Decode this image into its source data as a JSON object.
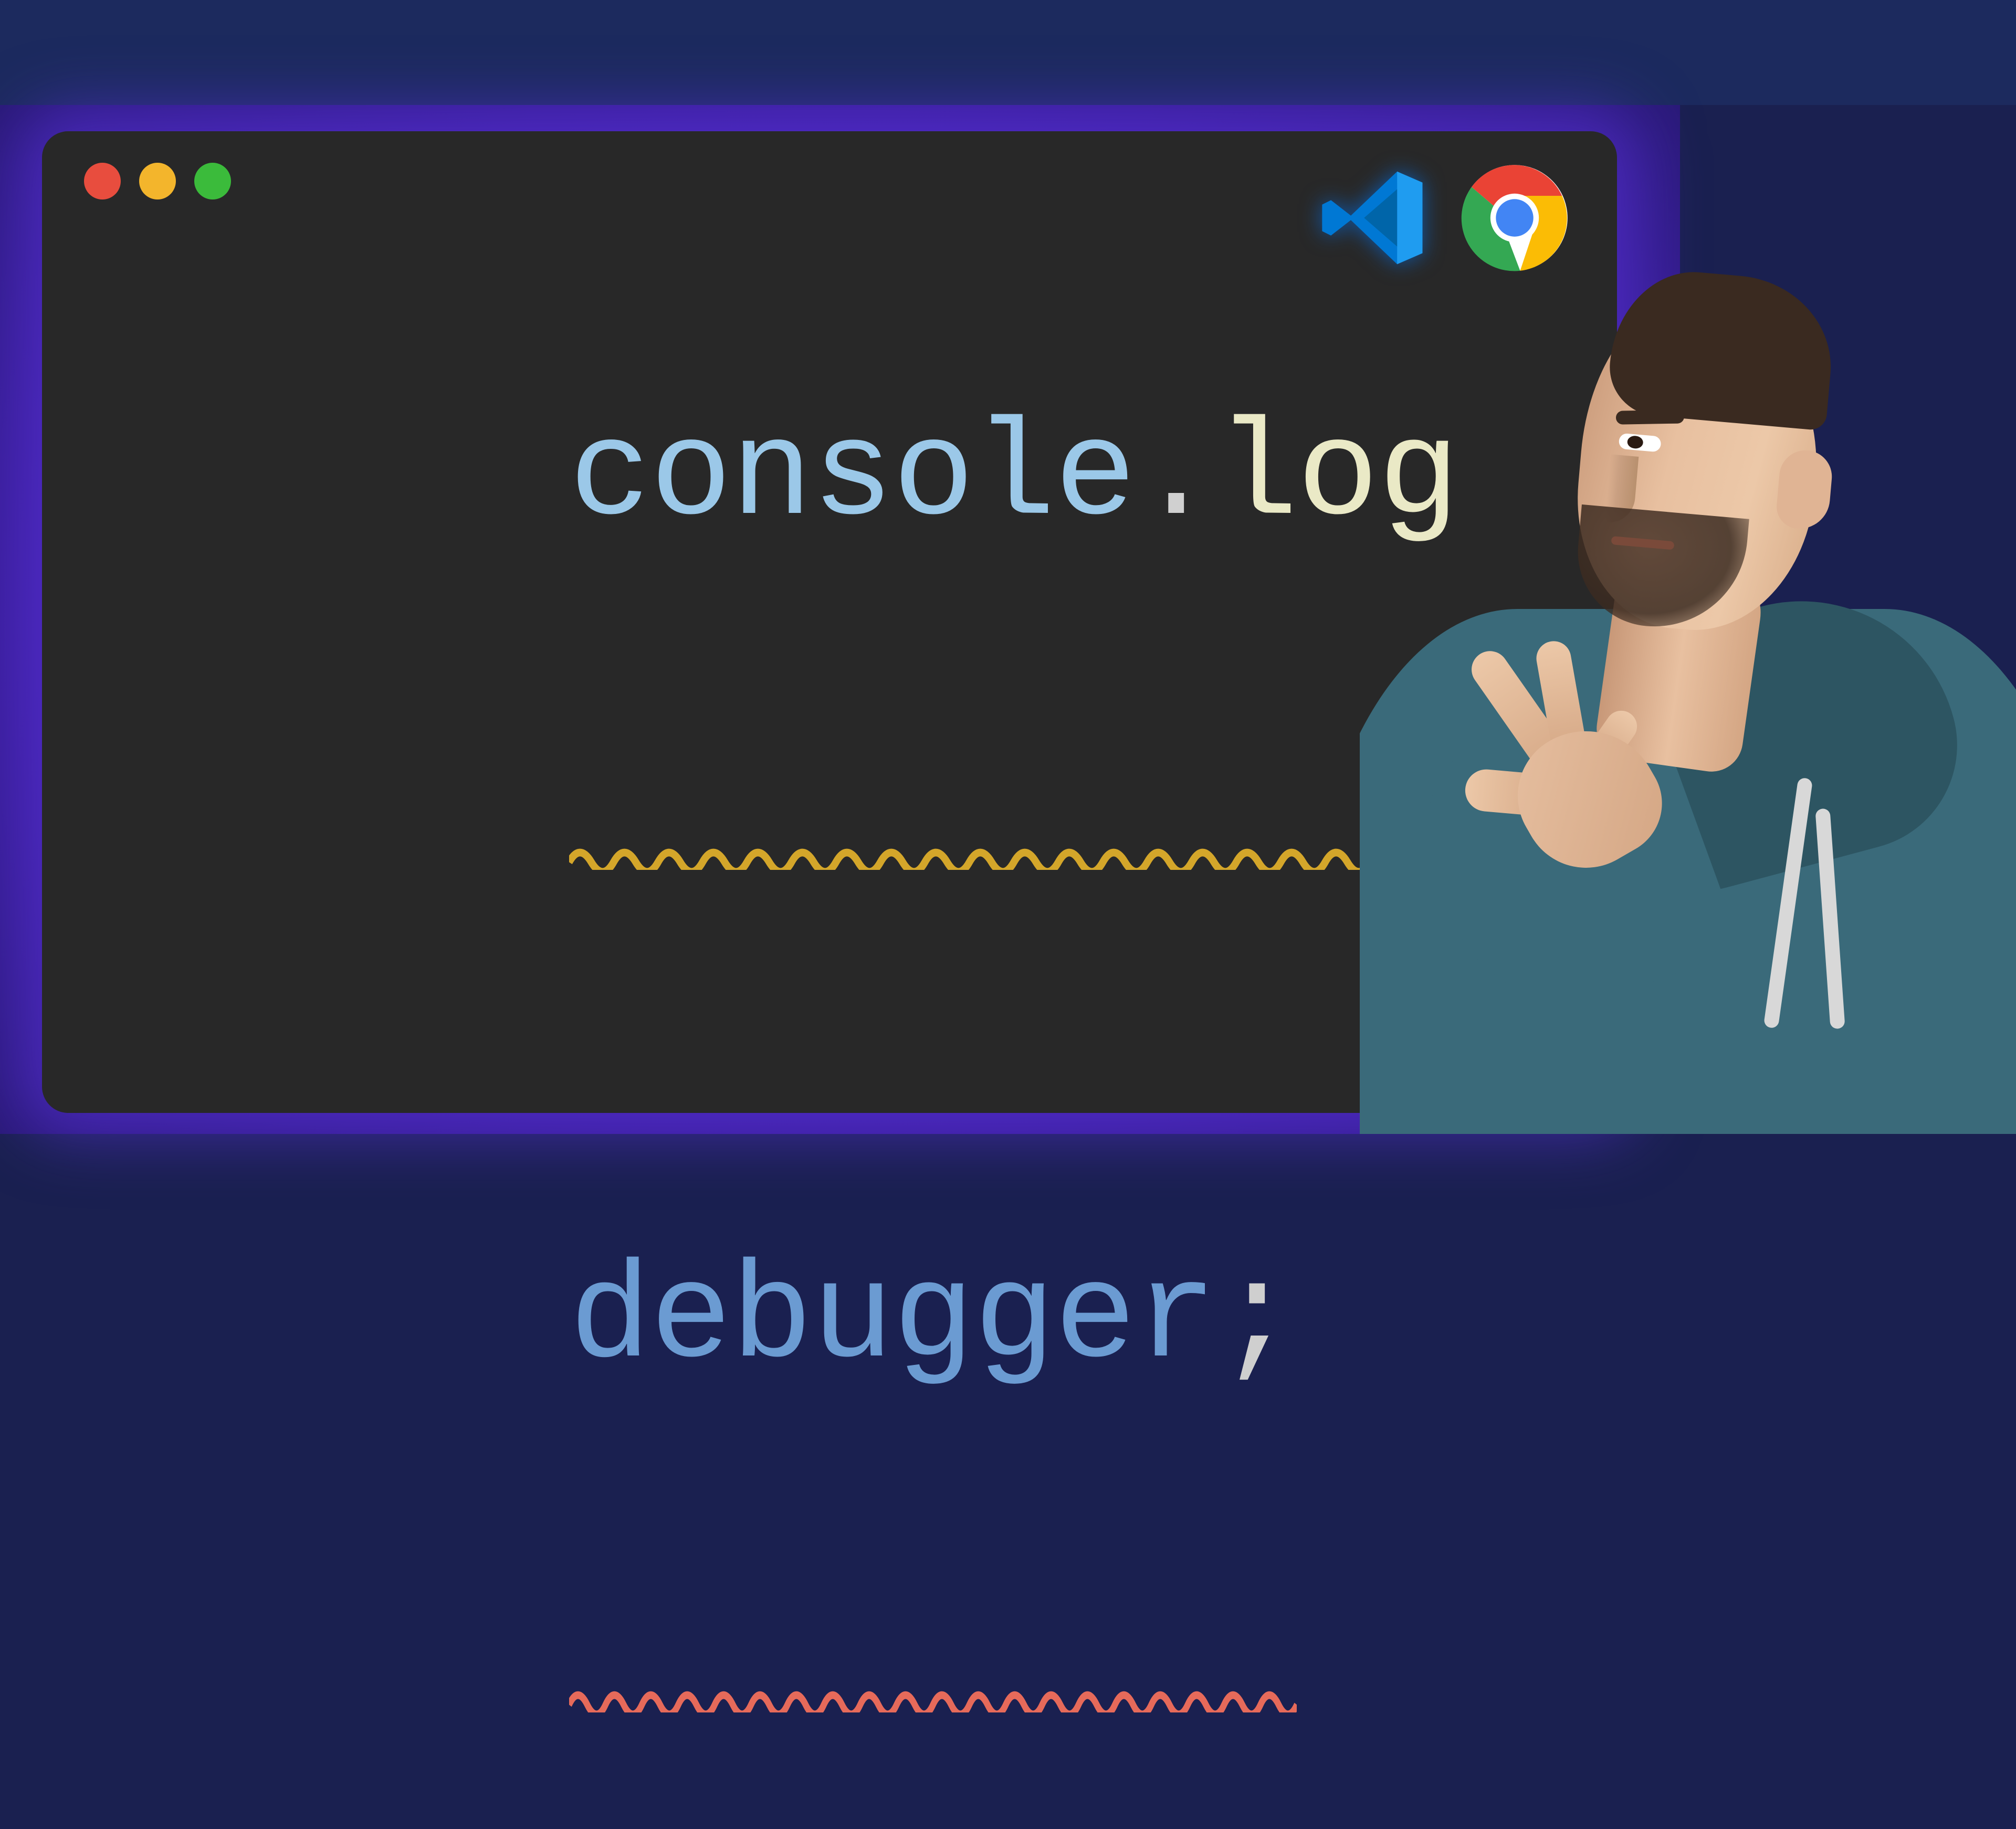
{
  "code": {
    "line1": {
      "object": "console",
      "dot": ".",
      "method": "log",
      "underline_color": "#d4a62a"
    },
    "line2": {
      "keyword": "debugger",
      "semicolon": ";",
      "underline_color": "#e66a5a"
    }
  },
  "icons": {
    "vscode": "vscode-icon",
    "chrome": "chrome-icon"
  },
  "colors": {
    "editor_bg": "#282828",
    "purple": "#5a2ed0",
    "navy": "#1a2050",
    "traffic_red": "#e84d3e",
    "traffic_yellow": "#f3b52c",
    "traffic_green": "#3bbb3b"
  }
}
